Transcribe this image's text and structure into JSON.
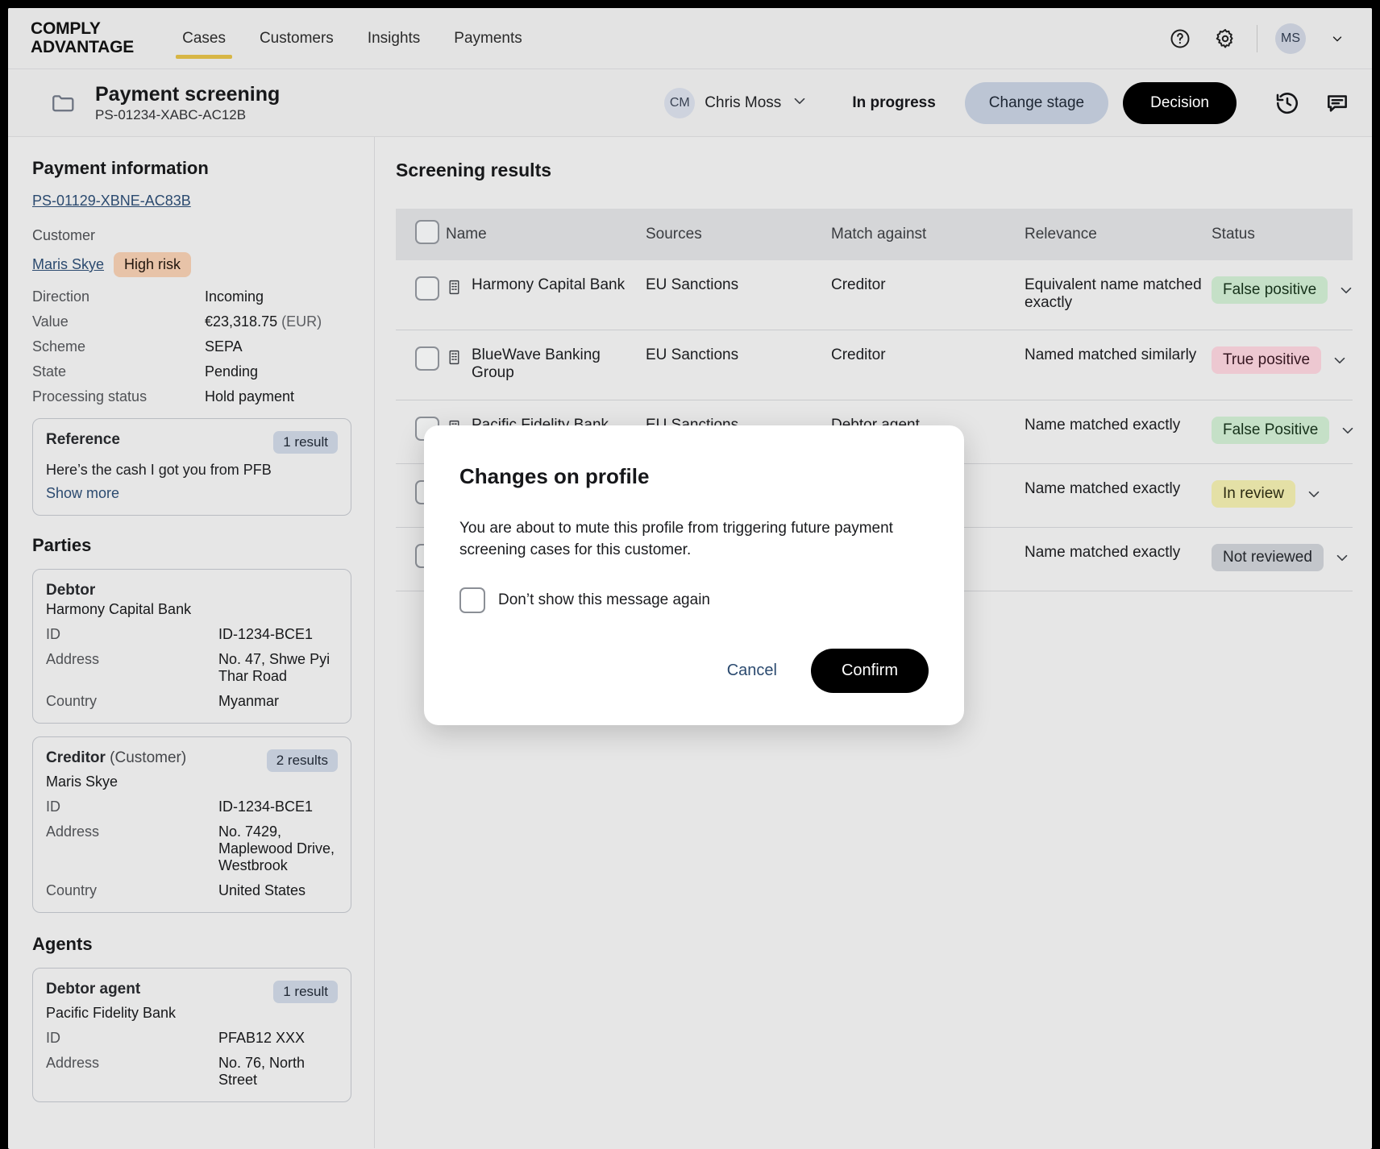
{
  "brand": {
    "line1": "COMPLY",
    "line2": "ADVANTAGE"
  },
  "topnav": {
    "tabs": [
      {
        "label": "Cases",
        "active": true
      },
      {
        "label": "Customers",
        "active": false
      },
      {
        "label": "Insights",
        "active": false
      },
      {
        "label": "Payments",
        "active": false
      }
    ],
    "help_icon": "help-circle-icon",
    "settings_icon": "gear-icon",
    "user_initials": "MS",
    "user_chevron": "chevron-down-icon"
  },
  "case_header": {
    "folder_icon": "folder-icon",
    "title": "Payment screening",
    "reference": "PS-01234-XABC-AC12B",
    "assignee_initials": "CM",
    "assignee_name": "Chris Moss",
    "assignee_chevron": "chevron-down-icon",
    "stage": "In progress",
    "change_stage_label": "Change stage",
    "decision_label": "Decision",
    "history_icon": "history-icon",
    "comments_icon": "comment-icon"
  },
  "sidebar": {
    "payment_information_title": "Payment information",
    "payment_id": "PS-01129-XBNE-AC83B",
    "customer_label": "Customer",
    "customer_name": "Maris Skye",
    "customer_risk": "High risk",
    "fields": [
      {
        "label": "Direction",
        "value": "Incoming"
      },
      {
        "label": "Value",
        "value": "€23,318.75",
        "suffix": "(EUR)"
      },
      {
        "label": "Scheme",
        "value": "SEPA"
      },
      {
        "label": "State",
        "value": "Pending"
      },
      {
        "label": "Processing status",
        "value": "Hold payment"
      }
    ],
    "reference_card": {
      "title": "Reference",
      "badge": "1 result",
      "text": "Here’s the cash I got you from PFB",
      "show_more": "Show more"
    },
    "parties_title": "Parties",
    "parties": [
      {
        "role": "Debtor",
        "role_extra": "",
        "badge": "",
        "name": "Harmony Capital Bank",
        "rows": [
          {
            "label": "ID",
            "value": "ID-1234-BCE1"
          },
          {
            "label": "Address",
            "value": "No. 47, Shwe Pyi Thar Road"
          },
          {
            "label": "Country",
            "value": "Myanmar"
          }
        ]
      },
      {
        "role": "Creditor",
        "role_extra": " (Customer)",
        "badge": "2 results",
        "name": "Maris Skye",
        "rows": [
          {
            "label": "ID",
            "value": "ID-1234-BCE1"
          },
          {
            "label": "Address",
            "value": "No. 7429, Maplewood Drive, Westbrook"
          },
          {
            "label": "Country",
            "value": "United States"
          }
        ]
      }
    ],
    "agents_title": "Agents",
    "agents": [
      {
        "role": "Debtor agent",
        "role_extra": "",
        "badge": "1 result",
        "name": "Pacific Fidelity Bank",
        "rows": [
          {
            "label": "ID",
            "value": "PFAB12 XXX"
          },
          {
            "label": "Address",
            "value": "No. 76, North Street"
          }
        ]
      }
    ]
  },
  "main": {
    "title": "Screening results",
    "columns": [
      "Name",
      "Sources",
      "Match against",
      "Relevance",
      "Status"
    ],
    "rows": [
      {
        "name": "Harmony Capital Bank",
        "sources": "EU Sanctions",
        "match_against": "Creditor",
        "relevance": "Equivalent name matched exactly",
        "status": "False positive",
        "status_color": "green",
        "muted_icon": "bell-off-icon"
      },
      {
        "name": "BlueWave Banking Group",
        "sources": "EU Sanctions",
        "match_against": "Creditor",
        "relevance": "Named matched similarly",
        "status": "True positive",
        "status_color": "pink",
        "muted_icon": ""
      },
      {
        "name": "Pacific Fidelity Bank",
        "sources": "EU Sanctions",
        "match_against": "Debtor agent",
        "relevance": "Name matched exactly",
        "status": "False Positive",
        "status_color": "green",
        "muted_icon": ""
      },
      {
        "name": "",
        "sources": "",
        "match_against": "",
        "relevance": "Name matched exactly",
        "status": "In review",
        "status_color": "yellow",
        "muted_icon": ""
      },
      {
        "name": "",
        "sources": "",
        "match_against": "",
        "relevance": "Name matched exactly",
        "status": "Not reviewed",
        "status_color": "grey",
        "muted_icon": ""
      }
    ]
  },
  "modal": {
    "title": "Changes on profile",
    "body": "You are about to mute this profile from triggering future payment screening cases for this customer.",
    "checkbox_label": "Don’t show this message again",
    "cancel_label": "Cancel",
    "confirm_label": "Confirm"
  },
  "colors": {
    "accent_yellow": "#d7b645",
    "link": "#2b4a6f",
    "risk_badge": "#e7c3a8",
    "status_green": "#c5e0c7",
    "status_pink": "#edc8d1",
    "status_yellow": "#e4e0a6",
    "status_grey": "#c3c6cb"
  }
}
